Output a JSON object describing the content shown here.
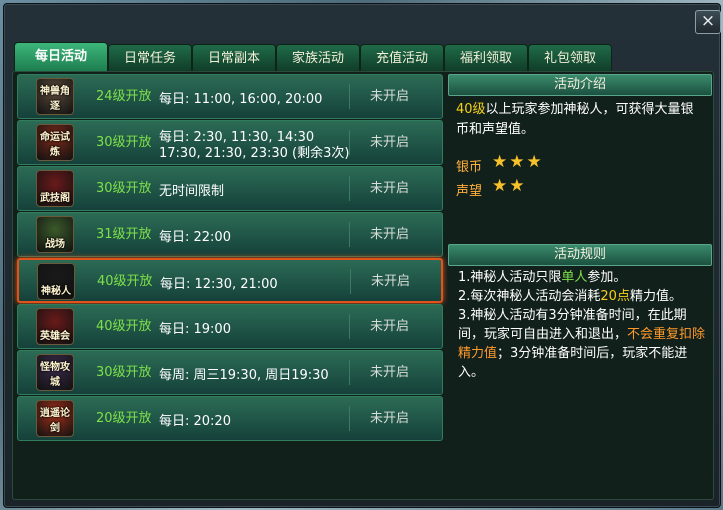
{
  "close_label": "×",
  "tabs": [
    "每日活动",
    "日常任务",
    "日常副本",
    "家族活动",
    "充值活动",
    "福利领取",
    "礼包领取"
  ],
  "activities": [
    {
      "icon_label": "神兽角逐",
      "level": "24级开放",
      "time_lines": [
        "每日: 11:00, 16:00, 20:00"
      ],
      "status": "未开启"
    },
    {
      "icon_label": "命运试炼",
      "level": "30级开放",
      "time_lines": [
        "每日: 2:30, 11:30, 14:30",
        "17:30, 21:30, 23:30 (剩余3次)"
      ],
      "status": "未开启"
    },
    {
      "icon_label": "武技阁",
      "level": "30级开放",
      "time_lines": [
        "无时间限制"
      ],
      "status": "未开启"
    },
    {
      "icon_label": "战场",
      "level": "31级开放",
      "time_lines": [
        "每日: 22:00"
      ],
      "status": "未开启"
    },
    {
      "icon_label": "神秘人",
      "level": "40级开放",
      "time_lines": [
        "每日: 12:30, 21:00"
      ],
      "status": "未开启"
    },
    {
      "icon_label": "英雄会",
      "level": "40级开放",
      "time_lines": [
        "每日: 19:00"
      ],
      "status": "未开启"
    },
    {
      "icon_label": "怪物攻城",
      "level": "30级开放",
      "time_lines": [
        "每周: 周三19:30, 周日19:30"
      ],
      "status": "未开启"
    },
    {
      "icon_label": "逍遥论剑",
      "level": "20级开放",
      "time_lines": [
        "每日: 20:20"
      ],
      "status": "未开启"
    }
  ],
  "selected_index": 4,
  "intro": {
    "header": "活动介绍",
    "level_text": "40级",
    "text": "以上玩家参加神秘人，可获得大量银币和声望值。",
    "rewards": [
      {
        "label": "银币",
        "stars": 3
      },
      {
        "label": "声望",
        "stars": 2
      }
    ]
  },
  "rules": {
    "header": "活动规则",
    "line1_a": "1.神秘人活动只限",
    "line1_b": "单人",
    "line1_c": "参加。",
    "line2_a": "2.每次神秘人活动会消耗",
    "line2_b": "20点",
    "line2_c": "精力值。",
    "line3_a": "3.神秘人活动有3分钟准备时间，在此期间，玩家可自由进入和退出，",
    "line3_b": "不会重复扣除精力值",
    "line3_c": "；3分钟准备时间后，玩家不能进入。"
  },
  "colors": {
    "level_green": "#7ee04a",
    "highlight_yellow": "#f5d01a",
    "highlight_orange": "#ff9a2a",
    "selected_border": "#e0541c"
  }
}
